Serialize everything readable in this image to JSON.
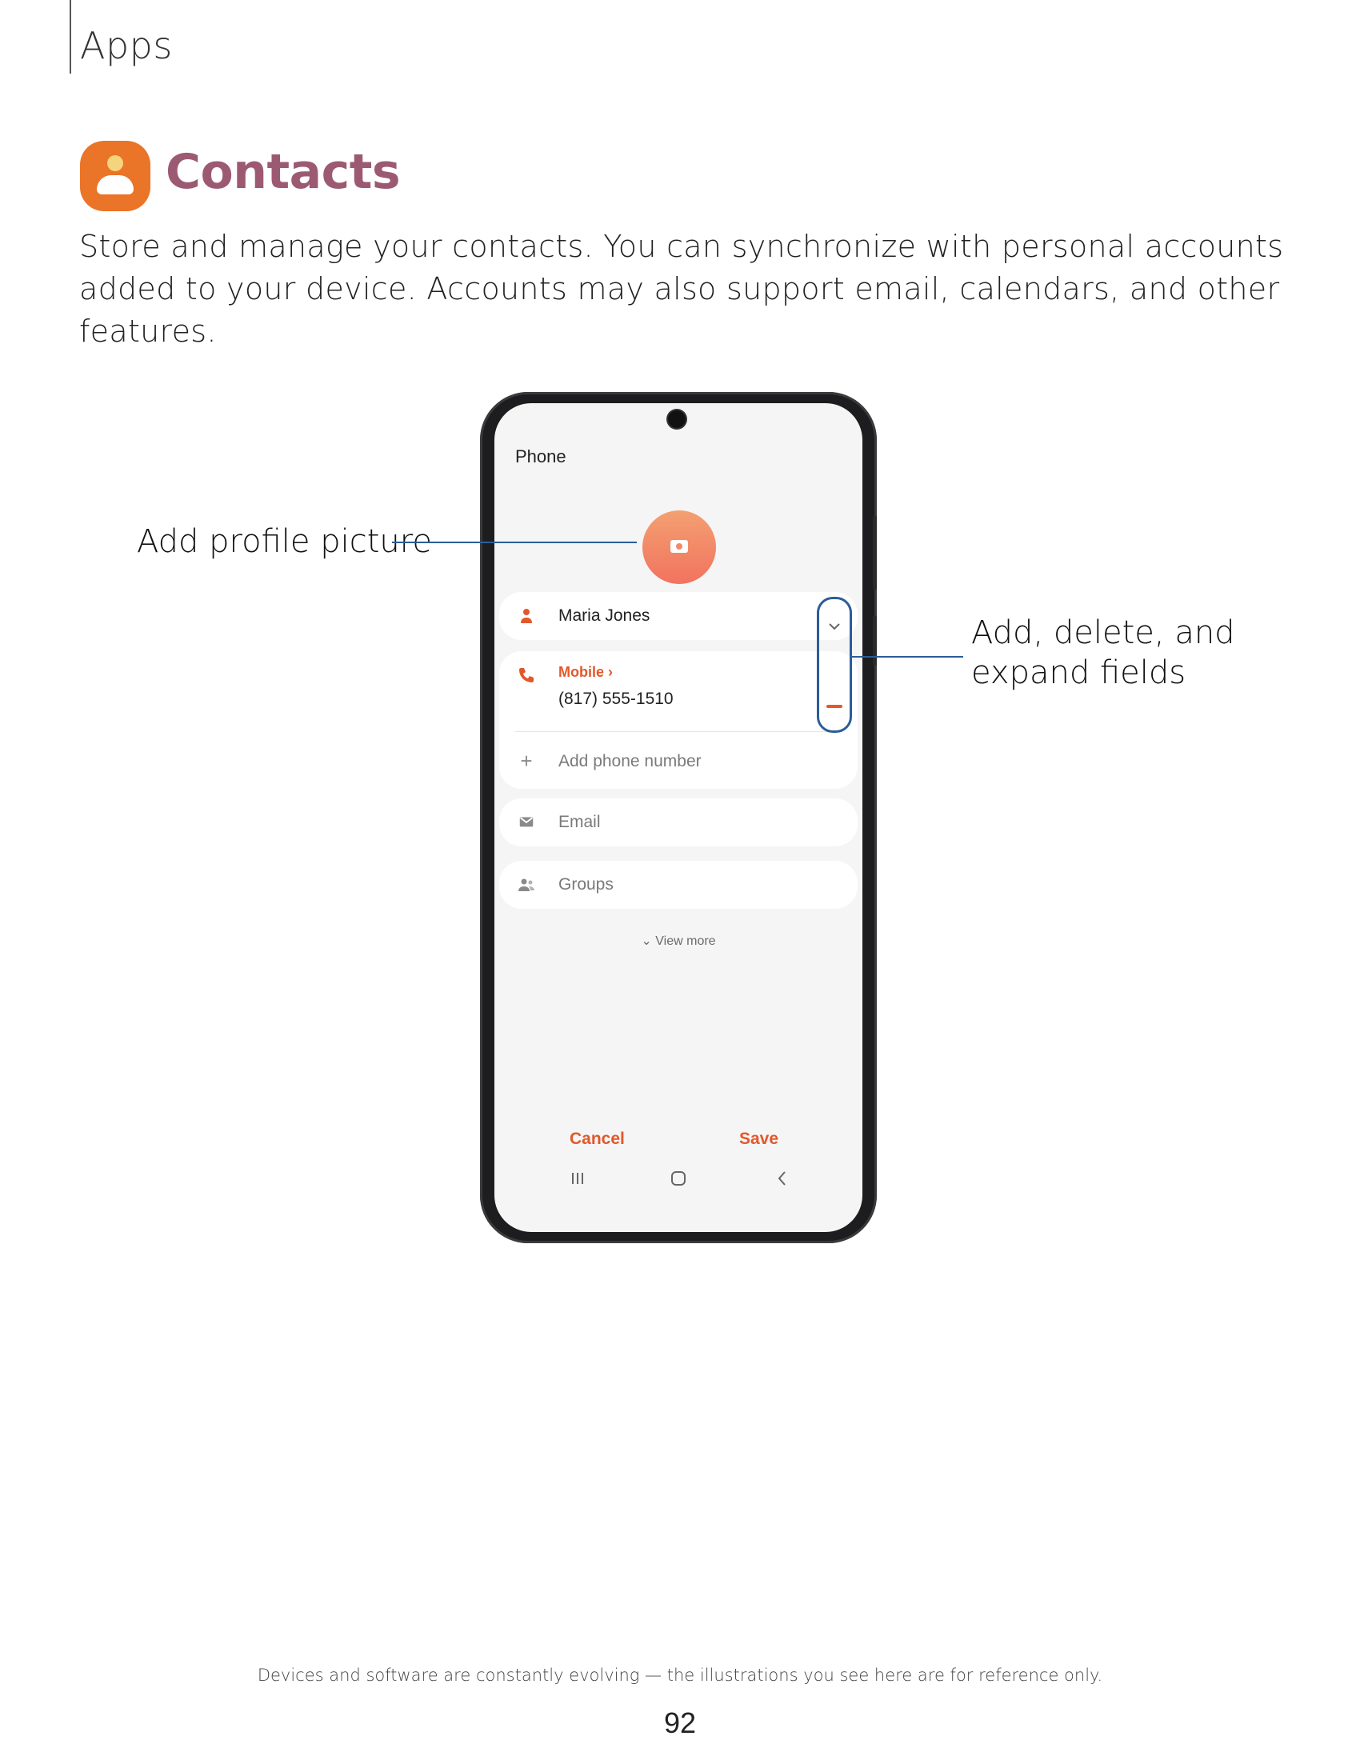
{
  "header": {
    "section": "Apps"
  },
  "title": {
    "text": "Contacts",
    "icon": "contacts-app-icon",
    "icon_color": "#ea7427",
    "title_color": "#9c5a72"
  },
  "intro": "Store and manage your contacts. You can synchronize with personal accounts added to your device. Accounts may also support email, calendars, and other features.",
  "phone_screen": {
    "title": "Phone",
    "profile_picture_icon": "camera-icon",
    "name_value": "Maria Jones",
    "phone_label": "Mobile",
    "phone_value": "(817) 555-1510",
    "add_phone_placeholder": "Add phone number",
    "email_placeholder": "Email",
    "groups_placeholder": "Groups",
    "view_more": "View more",
    "cancel": "Cancel",
    "save": "Save",
    "accent_color": "#e2582b"
  },
  "callouts": {
    "profile_picture": "Add profile picture",
    "fields_line1": "Add, delete, and",
    "fields_line2": "expand fields"
  },
  "footer": {
    "note": "Devices and software are constantly evolving — the illustrations you see here are for reference only.",
    "page_number": "92"
  }
}
